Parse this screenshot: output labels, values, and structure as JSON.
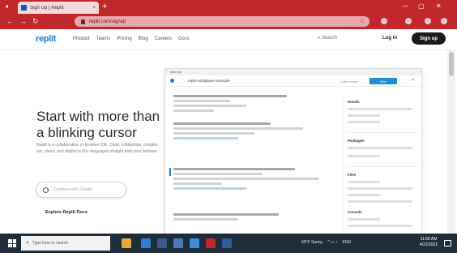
{
  "browser": {
    "tab_title": "Sign Up | Replit",
    "tab_close": "×",
    "new_tab": "+",
    "address": "replit.com/signup",
    "back": "←",
    "forward": "→",
    "reload": "↻",
    "accent": "#c0282b"
  },
  "site": {
    "logo": "replit",
    "nav": [
      "Product",
      "Teams",
      "Pricing",
      "Blog",
      "Careers",
      "Docs"
    ],
    "search": "Search",
    "login": "Log in",
    "signup": "Sign up"
  },
  "hero": {
    "title": "Start with more than a blinking cursor",
    "description": "Replit is a collaborative, in-browser IDE. Code, collaborate, compile, run, share, and deploy in 50+ languages straight from your browser.",
    "input_placeholder": "Continue with Google",
    "link": "Explore Replit Docs"
  },
  "preview": {
    "window_label": "main.py",
    "title": "replit-multiplayer-example",
    "meta": "1 user online",
    "run": "Run",
    "sidebar_headers": [
      "Details",
      "Packages",
      "Files",
      "Console"
    ]
  },
  "taskbar": {
    "search": "Type here to search",
    "clock_time": "11:59 AM",
    "clock_date": "4/22/2022",
    "weather": "60°F Sunny",
    "lang": "ENG"
  }
}
